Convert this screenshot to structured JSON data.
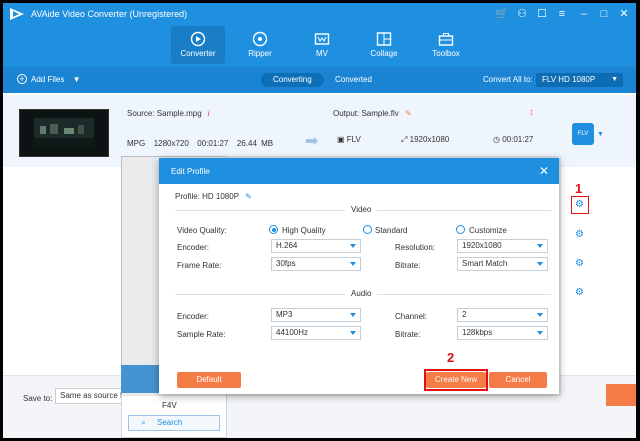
{
  "app": {
    "title": "AVAide Video Converter (Unregistered)"
  },
  "nav": {
    "tabs": [
      {
        "label": "Converter",
        "active": true
      },
      {
        "label": "Ripper"
      },
      {
        "label": "MV"
      },
      {
        "label": "Collage"
      },
      {
        "label": "Toolbox"
      }
    ]
  },
  "toolbar": {
    "add_files": "Add Files",
    "seg_converting": "Converting",
    "seg_converted": "Converted",
    "convert_all_label": "Convert All to:",
    "convert_all_value": "FLV HD 1080P"
  },
  "file": {
    "source_label": "Source: Sample.mpg",
    "info_icon": "i",
    "source_format": "MPG",
    "source_resolution": "1280x720",
    "source_duration": "00:01:27",
    "source_size": "26.44 MB",
    "output_label": "Output: Sample.flv",
    "output_format": "FLV",
    "output_resolution": "1920x1080",
    "output_duration": "00:01:27",
    "badge": "FLV"
  },
  "bottom": {
    "save_to_label": "Save to:",
    "save_to_value": "Same as source folder"
  },
  "popup": {
    "f4v": "F4V",
    "search": "Search"
  },
  "modal": {
    "title": "Edit Profile",
    "profile_label": "Profile: HD 1080P",
    "video_section": "Video",
    "audio_section": "Audio",
    "video_quality_label": "Video Quality:",
    "quality_options": [
      "High Quality",
      "Standard",
      "Customize"
    ],
    "video": {
      "encoder_label": "Encoder:",
      "encoder_value": "H.264",
      "frame_rate_label": "Frame Rate:",
      "frame_rate_value": "30fps",
      "resolution_label": "Resolution:",
      "resolution_value": "1920x1080",
      "bitrate_label": "Bitrate:",
      "bitrate_value": "Smart Match"
    },
    "audio": {
      "encoder_label": "Encoder:",
      "encoder_value": "MP3",
      "sample_rate_label": "Sample Rate:",
      "sample_rate_value": "44100Hz",
      "channel_label": "Channel:",
      "channel_value": "2",
      "bitrate_label": "Bitrate:",
      "bitrate_value": "128kbps"
    },
    "default_btn": "Default",
    "create_btn": "Create New",
    "cancel_btn": "Cancel"
  },
  "annotations": {
    "step1": "1",
    "step2": "2"
  },
  "colors": {
    "brand_blue": "#1f8fe0",
    "accent_orange": "#f57c47",
    "annotation_red": "#e01010"
  }
}
